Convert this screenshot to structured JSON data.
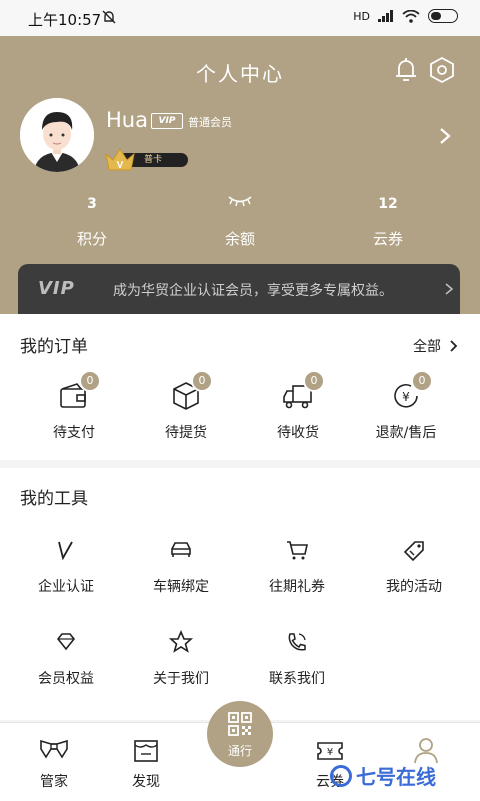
{
  "status_bar": {
    "time": "上午10:57",
    "network": "HD"
  },
  "header": {
    "title": "个人中心",
    "user": {
      "name": "Hua",
      "vip_label": "VIP",
      "level_name": "普通会员",
      "card_label": "普卡",
      "crown_letter": "V"
    },
    "stats": [
      {
        "value": "3",
        "label": "积分"
      },
      {
        "value": "",
        "label": "余额"
      },
      {
        "value": "12",
        "label": "云券"
      }
    ],
    "vip_banner": {
      "logo": "VIP",
      "text": "成为华贸企业认证会员，享受更多专属权益。"
    }
  },
  "orders": {
    "title": "我的订单",
    "all_label": "全部",
    "items": [
      {
        "label": "待支付",
        "badge": "0",
        "icon": "wallet-icon"
      },
      {
        "label": "待提货",
        "badge": "0",
        "icon": "box-icon"
      },
      {
        "label": "待收货",
        "badge": "0",
        "icon": "truck-icon"
      },
      {
        "label": "退款/售后",
        "badge": "0",
        "icon": "yen-refund-icon"
      }
    ]
  },
  "tools": {
    "title": "我的工具",
    "items": [
      {
        "label": "企业认证",
        "icon": "v-icon"
      },
      {
        "label": "车辆绑定",
        "icon": "car-icon"
      },
      {
        "label": "往期礼券",
        "icon": "cart-icon"
      },
      {
        "label": "我的活动",
        "icon": "tag-icon"
      },
      {
        "label": "会员权益",
        "icon": "diamond-icon"
      },
      {
        "label": "关于我们",
        "icon": "star-icon"
      },
      {
        "label": "联系我们",
        "icon": "phone-icon"
      }
    ]
  },
  "tabbar": {
    "items": [
      {
        "label": "管家",
        "icon": "bowtie-icon"
      },
      {
        "label": "发现",
        "icon": "shop-icon"
      },
      {
        "label": "通行",
        "icon": "qr-code-icon"
      },
      {
        "label": "云券",
        "icon": "coupon-icon"
      },
      {
        "label": "",
        "icon": "user-icon"
      }
    ]
  },
  "watermark": {
    "text": "七号在线"
  },
  "colors": {
    "accent": "#b1a285",
    "banner_dark": "#3c3c3c"
  }
}
